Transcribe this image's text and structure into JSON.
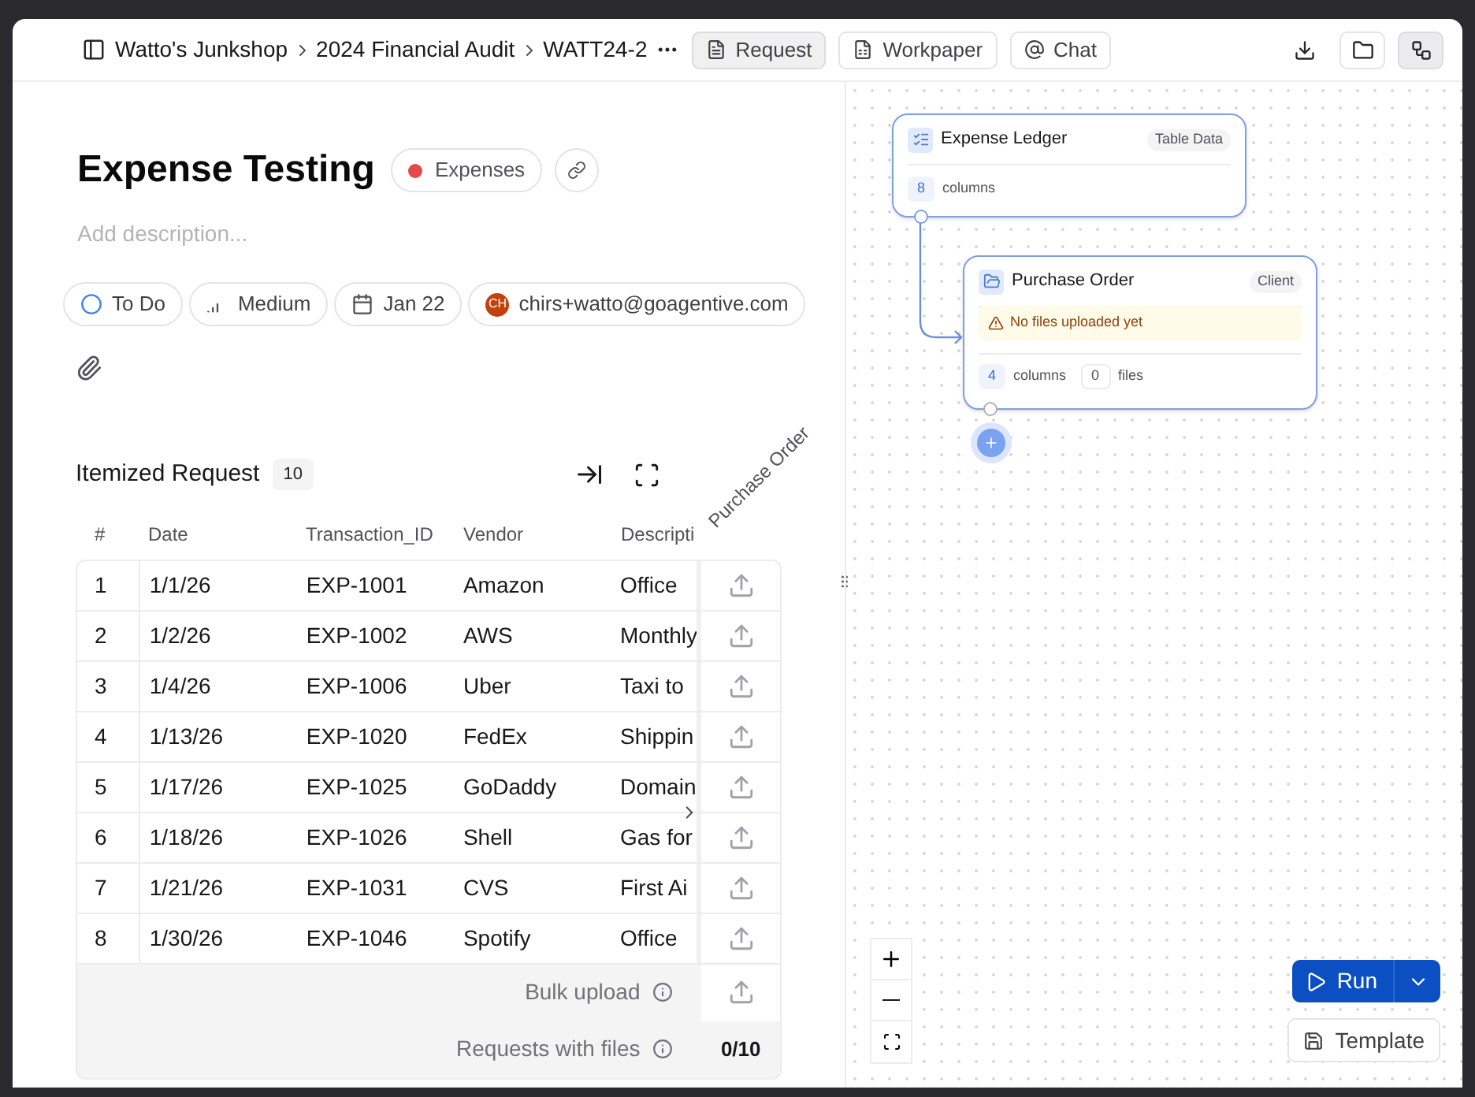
{
  "breadcrumbs": [
    "Watto's Junkshop",
    "2024 Financial Audit",
    "WATT24-2"
  ],
  "tabs": [
    {
      "label": "Request",
      "kind": "request",
      "selected": true
    },
    {
      "label": "Workpaper",
      "kind": "workpaper",
      "selected": false
    },
    {
      "label": "Chat",
      "kind": "chat",
      "selected": false
    }
  ],
  "toolbar": [
    {
      "kind": "download",
      "selected": false
    },
    {
      "kind": "folder",
      "selected": false
    },
    {
      "kind": "flow",
      "selected": true
    }
  ],
  "title": "Expense Testing",
  "tag": {
    "label": "Expenses",
    "color": "#e5484d"
  },
  "description": {
    "placeholder": "Add description..."
  },
  "properties": [
    {
      "kind": "status",
      "label": "To Do"
    },
    {
      "kind": "priority",
      "label": "Medium"
    },
    {
      "kind": "date",
      "label": "Jan 22"
    },
    {
      "kind": "assignee",
      "initials": "CH",
      "label": "chirs+watto@goagentive.com"
    }
  ],
  "itemized": {
    "title": "Itemized Request",
    "count": "10",
    "columns": [
      "#",
      "Date",
      "Transaction_ID",
      "Vendor",
      "Descripti",
      "Purchase Order"
    ],
    "rows": [
      [
        "1",
        "1/1/26",
        "EXP-1001",
        "Amazon",
        "Office"
      ],
      [
        "2",
        "1/2/26",
        "EXP-1002",
        "AWS",
        "Monthly"
      ],
      [
        "3",
        "1/4/26",
        "EXP-1006",
        "Uber",
        "Taxi to"
      ],
      [
        "4",
        "1/13/26",
        "EXP-1020",
        "FedEx",
        "Shippin"
      ],
      [
        "5",
        "1/17/26",
        "EXP-1025",
        "GoDaddy",
        "Domain"
      ],
      [
        "6",
        "1/18/26",
        "EXP-1026",
        "Shell",
        "Gas for"
      ],
      [
        "7",
        "1/21/26",
        "EXP-1031",
        "CVS",
        "First Ai"
      ],
      [
        "8",
        "1/30/26",
        "EXP-1046",
        "Spotify",
        "Office"
      ]
    ],
    "bulk_upload": "Bulk upload",
    "requests_with_files": "Requests with files",
    "files_count": "0/10"
  },
  "nodes": [
    {
      "kind": "table",
      "title": "Expense Ledger",
      "badge": "Table Data",
      "columns": "8",
      "columns_label": "columns"
    },
    {
      "kind": "client",
      "title": "Purchase Order",
      "badge": "Client",
      "warning": "No files uploaded yet",
      "columns": "4",
      "columns_label": "columns",
      "files": "0",
      "files_label": "files"
    }
  ],
  "run_button": "Run",
  "template_button": "Template"
}
